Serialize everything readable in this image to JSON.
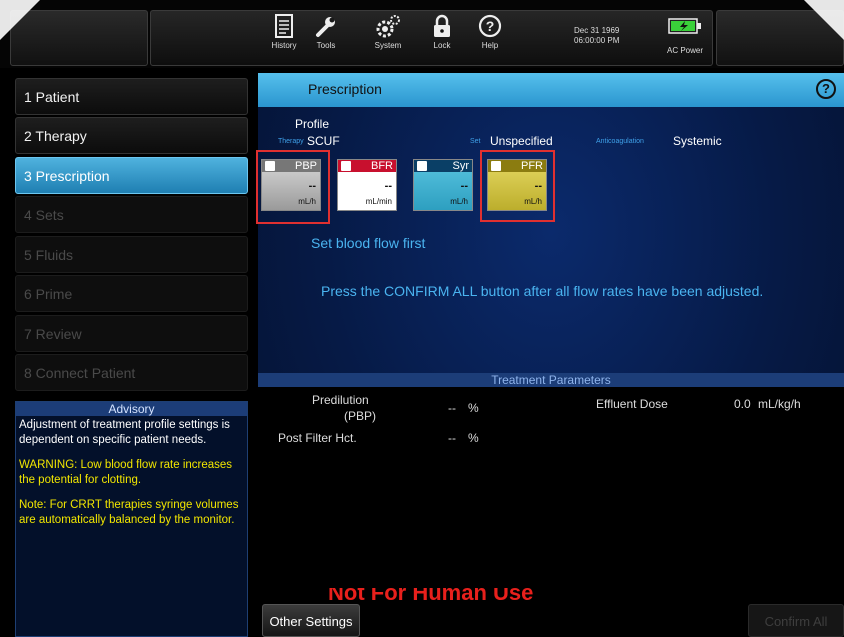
{
  "toolbar": {
    "items": [
      {
        "label": "History",
        "icon": "document-icon"
      },
      {
        "label": "Tools",
        "icon": "wrench-icon"
      },
      {
        "label": "System",
        "icon": "gears-icon"
      },
      {
        "label": "Lock",
        "icon": "padlock-icon"
      },
      {
        "label": "Help",
        "icon": "question-icon"
      }
    ],
    "date": "Dec 31 1969",
    "time": "06:00:00 PM",
    "power_label": "AC Power",
    "battery_color": "#3ad13a"
  },
  "nav": {
    "steps": [
      {
        "label": "1 Patient",
        "state": "enabled"
      },
      {
        "label": "2 Therapy",
        "state": "enabled"
      },
      {
        "label": "3 Prescription",
        "state": "active"
      },
      {
        "label": "4 Sets",
        "state": "disabled"
      },
      {
        "label": "5 Fluids",
        "state": "disabled"
      },
      {
        "label": "6 Prime",
        "state": "disabled"
      },
      {
        "label": "7 Review",
        "state": "disabled"
      },
      {
        "label": "8 Connect Patient",
        "state": "disabled"
      }
    ]
  },
  "advisory": {
    "title": "Advisory",
    "text1": "Adjustment of treatment profile settings is dependent on specific patient needs.",
    "text2": "WARNING: Low blood flow rate increases the potential for clotting.",
    "text3": "Note: For CRRT therapies syringe volumes are automatically balanced by the monitor."
  },
  "prescription": {
    "title": "Prescription",
    "help": "?",
    "profile_label": "Profile",
    "therapy_label": "Therapy",
    "therapy_value": "SCUF",
    "set_label": "Set",
    "set_value": "Unspecified",
    "anticoag_label": "Anticoagulation",
    "anticoag_value": "Systemic",
    "tiles": [
      {
        "name": "PBP",
        "value": "--",
        "unit": "mL/h",
        "color": "#9a9a9a"
      },
      {
        "name": "BFR",
        "value": "--",
        "unit": "mL/min",
        "color": "#c8102e"
      },
      {
        "name": "Syr",
        "value": "--",
        "unit": "mL/h",
        "color": "#2d9fc0"
      },
      {
        "name": "PFR",
        "value": "--",
        "unit": "mL/h",
        "color": "#bcae2c"
      }
    ],
    "set_bf_msg": "Set blood flow first",
    "confirm_msg": "Press the CONFIRM ALL button after all flow rates have been adjusted."
  },
  "treatment": {
    "title": "Treatment Parameters",
    "predilution_label_1": "Predilution",
    "predilution_label_2": "(PBP)",
    "predilution_value": "--",
    "predilution_unit": "%",
    "hct_label": "Post Filter Hct.",
    "hct_value": "--",
    "hct_unit": "%",
    "effluent_label": "Effluent Dose",
    "effluent_value": "0.0",
    "effluent_unit": "mL/kg/h",
    "watermark": "Not For Human Use"
  },
  "buttons": {
    "other_settings": "Other Settings",
    "confirm_all": "Confirm All"
  }
}
